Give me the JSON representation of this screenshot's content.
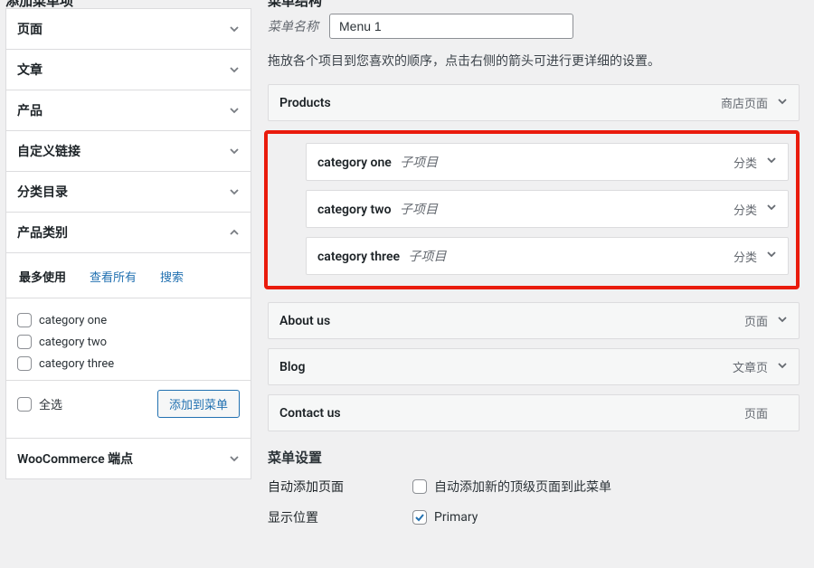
{
  "left": {
    "heading": "添加菜单项",
    "accordion": [
      {
        "label": "页面",
        "open": false
      },
      {
        "label": "文章",
        "open": false
      },
      {
        "label": "产品",
        "open": false
      },
      {
        "label": "自定义链接",
        "open": false
      },
      {
        "label": "分类目录",
        "open": false
      },
      {
        "label": "产品类别",
        "open": true,
        "tabs": {
          "most": "最多使用",
          "all": "查看所有",
          "search": "搜索"
        },
        "items": [
          {
            "label": "category one"
          },
          {
            "label": "category two"
          },
          {
            "label": "category three"
          }
        ],
        "footer": {
          "select_all": "全选",
          "add": "添加到菜单"
        }
      },
      {
        "label": "WooCommerce 端点",
        "open": false
      }
    ]
  },
  "right": {
    "heading": "菜单结构",
    "name_label": "菜单名称",
    "name_value": "Menu 1",
    "instructions": "拖放各个项目到您喜欢的顺序，点击右侧的箭头可进行更详细的设置。",
    "items": {
      "products": {
        "title": "Products",
        "type": "商店页面"
      },
      "cats": [
        {
          "title": "category one",
          "sub": "子项目",
          "type": "分类"
        },
        {
          "title": "category two",
          "sub": "子项目",
          "type": "分类"
        },
        {
          "title": "category three",
          "sub": "子项目",
          "type": "分类"
        }
      ],
      "about": {
        "title": "About us",
        "type": "页面"
      },
      "blog": {
        "title": "Blog",
        "type": "文章页"
      },
      "contact": {
        "title": "Contact us",
        "type": "页面"
      }
    },
    "settings": {
      "heading": "菜单设置",
      "auto_add_label": "自动添加页面",
      "auto_add_option": "自动添加新的顶级页面到此菜单",
      "position_label": "显示位置",
      "position_option": "Primary"
    }
  }
}
